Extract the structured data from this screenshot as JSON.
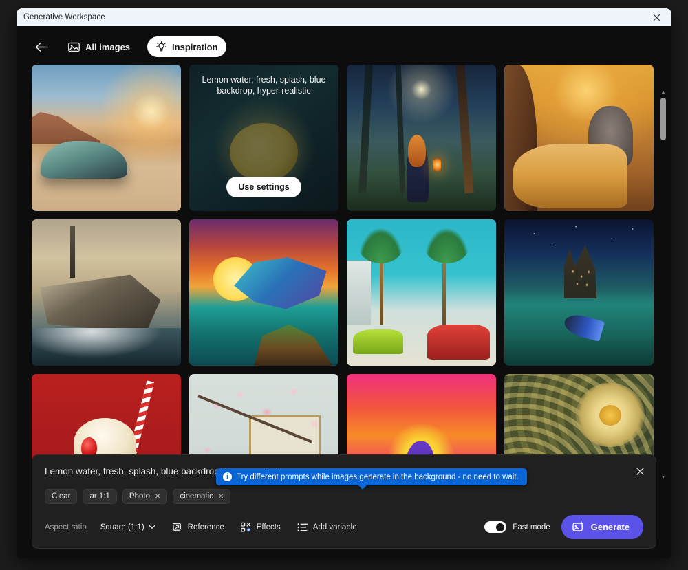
{
  "window": {
    "title": "Generative Workspace",
    "close_label": "✕"
  },
  "toolbar": {
    "back_icon": "arrow-left-icon",
    "all_images_label": "All images",
    "all_images_icon": "image-icon",
    "inspiration_label": "Inspiration",
    "inspiration_icon": "lightbulb-icon",
    "inspiration_active": true
  },
  "gallery": {
    "hovered_card_index": 1,
    "selected_card_index": 6,
    "use_settings_label": "Use settings",
    "hovered_prompt": "Lemon water, fresh, splash, blue backdrop, hyper-realistic",
    "cards": [
      {
        "name": "vintage-car-desert-sunset",
        "art": "art-car"
      },
      {
        "name": "lemon-water-splash",
        "art": "art-lemon"
      },
      {
        "name": "girl-lantern-moonlit-forest",
        "art": "art-forest"
      },
      {
        "name": "cheetah-elephants-savanna-sunset",
        "art": "art-savanna"
      },
      {
        "name": "battleship-stormy-sea-seagulls",
        "art": "art-ship"
      },
      {
        "name": "dragon-island-sunset-illustration",
        "art": "art-dragon"
      },
      {
        "name": "miami-palms-retro-cars-sketch",
        "art": "art-miami"
      },
      {
        "name": "mermaid-underwater-castle-night",
        "art": "art-mermaid"
      },
      {
        "name": "milkshake-cherry-red-backdrop",
        "art": "art-shake"
      },
      {
        "name": "cherry-blossom-framed-artwork",
        "art": "art-blossom"
      },
      {
        "name": "neon-horses-sunset-poster",
        "art": "art-horses"
      },
      {
        "name": "golden-lotus-art-nouveau",
        "art": "art-lotus"
      }
    ]
  },
  "scrollbar": {
    "up_arrow": "▲",
    "down_arrow": "▼"
  },
  "toast": {
    "icon": "info-icon",
    "icon_glyph": "i",
    "message": "Try different prompts while images generate in the background - no need to wait."
  },
  "prompt_bar": {
    "prompt_text": "Lemon water, fresh, splash, blue backdrop, hyper-realistic",
    "close_label": "✕",
    "chips": [
      {
        "label": "Clear",
        "removable": false
      },
      {
        "label": "ar 1:1",
        "removable": false
      },
      {
        "label": "Photo",
        "removable": true
      },
      {
        "label": "cinematic",
        "removable": true
      }
    ],
    "remove_glyph": "✕",
    "aspect_ratio_label": "Aspect ratio",
    "aspect_ratio_value": "Square (1:1)",
    "aspect_ratio_caret": "⌄",
    "reference_label": "Reference",
    "reference_icon": "reference-image-icon",
    "effects_label": "Effects",
    "effects_icon": "effects-icon",
    "add_variable_label": "Add variable",
    "add_variable_icon": "list-icon",
    "fast_mode_label": "Fast mode",
    "fast_mode_on": true,
    "generate_label": "Generate",
    "generate_icon": "sparkle-image-icon",
    "generate_color": "#5b52e8"
  }
}
